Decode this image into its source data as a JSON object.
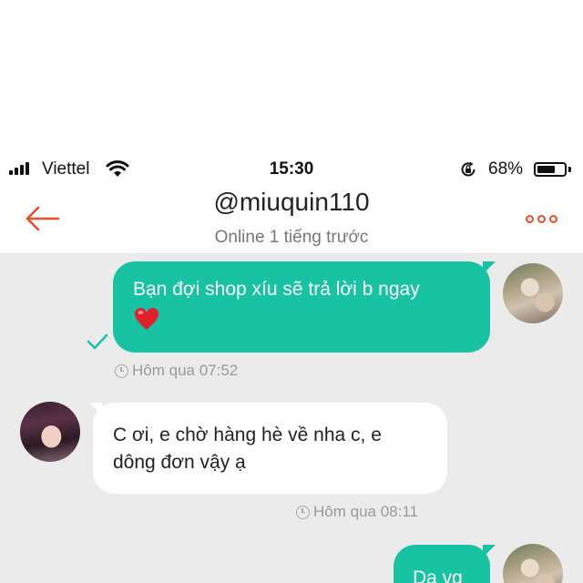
{
  "status_bar": {
    "carrier": "Viettel",
    "time": "15:30",
    "battery_percent": "68%",
    "battery_level": 0.68,
    "icons": [
      "signal-icon",
      "wifi-icon",
      "rotation-lock-icon",
      "battery-icon"
    ]
  },
  "header": {
    "title": "@miuquin110",
    "subtitle": "Online 1 tiếng trước",
    "back_icon": "arrow-left-icon",
    "more_icon": "more-dots-icon",
    "accent_color": "#ee4d2d"
  },
  "colors": {
    "outgoing_bubble": "#17c3a2",
    "incoming_bubble": "#ffffff",
    "chat_background": "#ebebeb"
  },
  "messages": [
    {
      "direction": "outgoing",
      "text": "Bạn đợi shop xíu sẽ trả lời b ngay",
      "emoji": "red-heart-icon",
      "time": "Hôm qua 07:52",
      "status_icon": "check-icon"
    },
    {
      "direction": "incoming",
      "text": "C ơi, e chờ hàng hè về nha c, e dông đơn vậy ạ",
      "time": "Hôm qua 08:11"
    },
    {
      "direction": "outgoing",
      "text": "Da vg"
    }
  ]
}
